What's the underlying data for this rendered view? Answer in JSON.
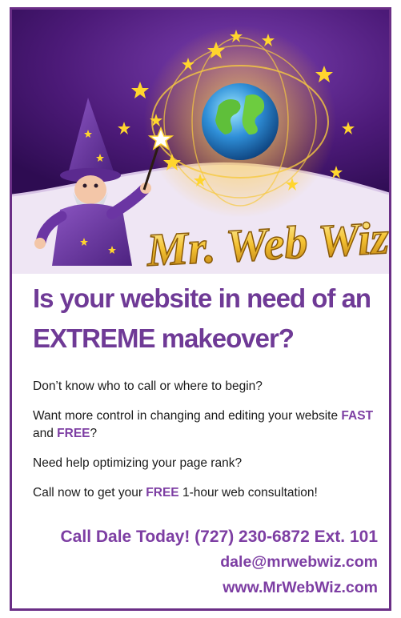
{
  "brand": {
    "logo_text": "Mr. Web Wiz",
    "colors": {
      "purple": "#6f3a96",
      "deep_purple": "#3d1463",
      "gold": "#f2c230",
      "text": "#1b1b1b"
    }
  },
  "headline": {
    "line1": "Is your website in need of an",
    "line2": "EXTREME makeover?"
  },
  "bullets": [
    {
      "parts": [
        {
          "text": "Don’t know who to call or where to begin?",
          "highlight": false
        }
      ]
    },
    {
      "parts": [
        {
          "text": "Want more control in changing and editing your website ",
          "highlight": false
        },
        {
          "text": "FAST",
          "highlight": true
        },
        {
          "text": " and ",
          "highlight": false
        },
        {
          "text": "FREE",
          "highlight": true
        },
        {
          "text": "?",
          "highlight": false
        }
      ]
    },
    {
      "parts": [
        {
          "text": "Need help optimizing your page rank?",
          "highlight": false
        }
      ]
    },
    {
      "parts": [
        {
          "text": "Call now to get your ",
          "highlight": false
        },
        {
          "text": "FREE",
          "highlight": true
        },
        {
          "text": " 1-hour web consultation!",
          "highlight": false
        }
      ]
    }
  ],
  "contact": {
    "phone_line": "Call Dale Today! (727) 230-6872 Ext. 101",
    "email": "dale@mrwebwiz.com",
    "website": "www.MrWebWiz.com"
  },
  "icons": [
    "wizard-illustration",
    "globe-icon",
    "star-icon",
    "magic-wand-icon"
  ]
}
